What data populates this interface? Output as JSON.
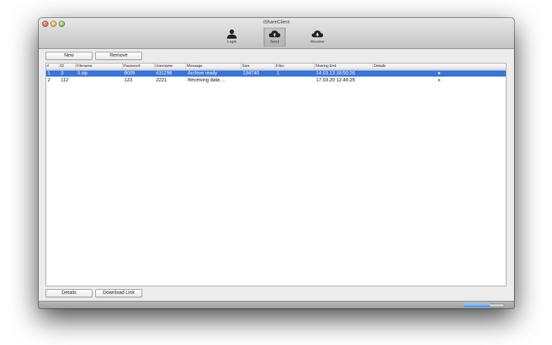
{
  "window": {
    "title": "iShareClient"
  },
  "toolbar": {
    "items": [
      {
        "label": "Login",
        "icon": "person-icon",
        "selected": false
      },
      {
        "label": "Send",
        "icon": "cloud-upload-icon",
        "selected": true
      },
      {
        "label": "Receive",
        "icon": "cloud-download-icon",
        "selected": false
      }
    ]
  },
  "actions": {
    "new_label": "New",
    "remove_label": "Remove",
    "details_label": "Details",
    "download_link_label": "Download Link"
  },
  "table": {
    "columns": [
      "#",
      "ID",
      "Filename",
      "Password",
      "Username",
      "Message",
      "Size",
      "Files",
      "Sharing End",
      "Details"
    ],
    "rows": [
      {
        "num": "1",
        "id": "3",
        "filename": "3.zip",
        "password": "8009",
        "username": "431296",
        "message": "Archive ready",
        "size": "134740",
        "files": "1",
        "sharing_end": "14.03.13 18:50:26",
        "selected": true
      },
      {
        "num": "2",
        "id": "112",
        "filename": "",
        "password": "123",
        "username": "2221",
        "message": "Receiving data ...",
        "size": "",
        "files": "",
        "sharing_end": "17.03.20 12:46:25",
        "selected": false
      }
    ]
  },
  "status": {
    "progress": 0.65
  },
  "colors": {
    "selection": "#3a74d8",
    "progress": "#3a8df0"
  }
}
